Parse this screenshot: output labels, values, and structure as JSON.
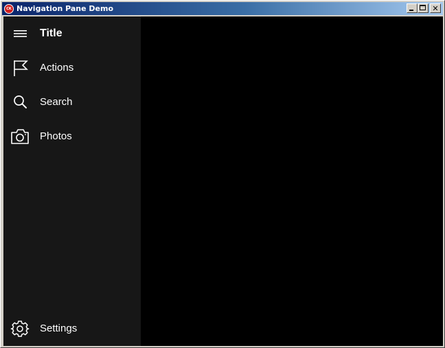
{
  "window": {
    "title": "Navigation Pane Demo",
    "app_icon_text": "CK",
    "buttons": {
      "minimize": "minimize",
      "maximize": "maximize",
      "close": "✕"
    }
  },
  "nav": {
    "header": {
      "label": "Title",
      "icon": "hamburger-icon"
    },
    "items": [
      {
        "label": "Actions",
        "icon": "flag-icon"
      },
      {
        "label": "Search",
        "icon": "search-icon"
      },
      {
        "label": "Photos",
        "icon": "camera-icon"
      }
    ],
    "footer": {
      "label": "Settings",
      "icon": "gear-icon"
    }
  },
  "colors": {
    "nav_background": "#171717",
    "content_background": "#000000",
    "text": "#ffffff"
  }
}
